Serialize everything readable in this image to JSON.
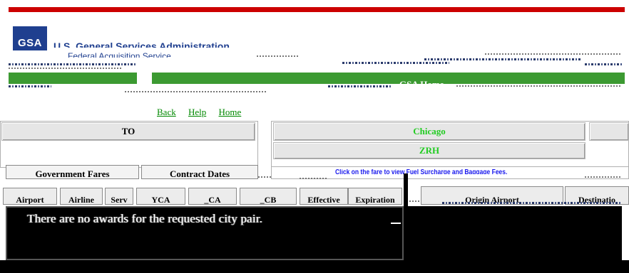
{
  "header": {
    "logo_text": "GSA",
    "agency_name": "U.S. General Services Administration",
    "agency_subname": "Federal Acquisition Service",
    "gsa_home": "GSA Home"
  },
  "links": {
    "back": "Back",
    "help": "Help",
    "home": "Home"
  },
  "route": {
    "to_label": "TO",
    "origin_city": "Chicago",
    "destination_code": "ZRH"
  },
  "tabs": {
    "government_fares": "Government Fares",
    "contract_dates": "Contract Dates"
  },
  "notes": {
    "fare_click": "Click on the fare to view Fuel Surcharge and Baggage Fees."
  },
  "table": {
    "headers": [
      "Airport",
      "Airline",
      "Serv",
      "YCA",
      "_CA",
      "_CB",
      "Effective",
      "Expiration",
      "Origin Airport",
      "Destinatio"
    ]
  },
  "results": {
    "message": "There are no awards for the requested city pair."
  },
  "colors": {
    "accent_red": "#cc0000",
    "nav_green": "#3c9a32",
    "link_green": "#008800",
    "city_green": "#22cc22",
    "brand_blue": "#1f3f8f",
    "note_blue": "#1a1aee"
  }
}
